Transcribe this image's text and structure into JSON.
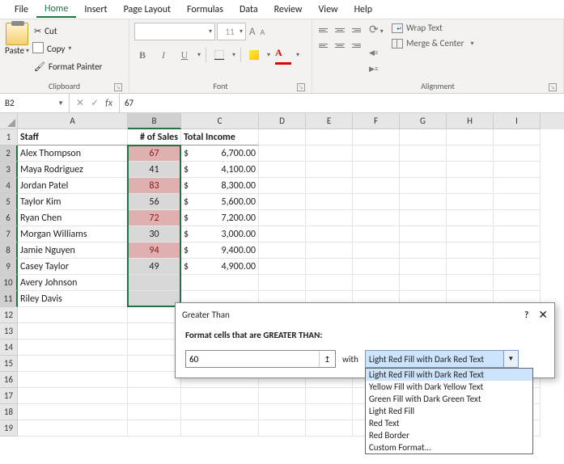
{
  "menu": {
    "items": [
      "File",
      "Home",
      "Insert",
      "Page Layout",
      "Formulas",
      "Data",
      "Review",
      "View",
      "Help"
    ],
    "active": 1
  },
  "ribbon": {
    "clipboard": {
      "paste": "Paste",
      "cut": "Cut",
      "copy": "Copy",
      "format_painter": "Format Painter",
      "label": "Clipboard"
    },
    "font": {
      "label": "Font",
      "bold": "B",
      "italic": "I",
      "underline": "U",
      "increase": "A",
      "decrease": "A",
      "color_glyph": "A"
    },
    "alignment": {
      "label": "Alignment",
      "wrap": "Wrap Text",
      "merge": "Merge & Center"
    }
  },
  "formula_bar": {
    "name_box": "B2",
    "value": "67"
  },
  "columns": [
    "A",
    "B",
    "C",
    "D",
    "E",
    "F",
    "G",
    "H",
    "I"
  ],
  "headers": {
    "A": "Staff",
    "B": "# of Sales",
    "C": "Total Income"
  },
  "rows": [
    {
      "staff": "Alex Thompson",
      "sales": 67,
      "income": "6,700.00",
      "hi": true
    },
    {
      "staff": "Maya Rodriguez",
      "sales": 41,
      "income": "4,100.00",
      "hi": false
    },
    {
      "staff": "Jordan Patel",
      "sales": 83,
      "income": "8,300.00",
      "hi": true
    },
    {
      "staff": "Taylor Kim",
      "sales": 56,
      "income": "5,600.00",
      "hi": false
    },
    {
      "staff": "Ryan Chen",
      "sales": 72,
      "income": "7,200.00",
      "hi": true
    },
    {
      "staff": "Morgan Williams",
      "sales": 30,
      "income": "3,000.00",
      "hi": false
    },
    {
      "staff": "Jamie Nguyen",
      "sales": 94,
      "income": "9,400.00",
      "hi": true
    },
    {
      "staff": "Casey Taylor",
      "sales": 49,
      "income": "4,900.00",
      "hi": false
    },
    {
      "staff": "Avery Johnson",
      "sales": "",
      "income": "",
      "hi": false
    },
    {
      "staff": "Riley Davis",
      "sales": "",
      "income": "",
      "hi": false
    }
  ],
  "currency": "$",
  "total_rows": 19,
  "selected_col": "B",
  "dialog": {
    "title": "Greater Than",
    "help": "?",
    "prompt": "Format cells that are GREATER THAN:",
    "value": "60",
    "with": "with",
    "selected": "Light Red Fill with Dark Red Text",
    "options": [
      "Light Red Fill with Dark Red Text",
      "Yellow Fill with Dark Yellow Text",
      "Green Fill with Dark Green Text",
      "Light Red Fill",
      "Red Text",
      "Red Border",
      "Custom Format..."
    ]
  }
}
